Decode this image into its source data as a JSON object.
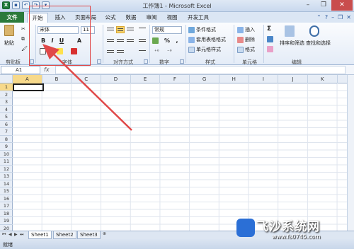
{
  "window": {
    "title": "工作簿1 - Microsoft Excel"
  },
  "tabs": {
    "file": "文件",
    "home": "开始",
    "insert": "插入",
    "layout": "页面布局",
    "formulas": "公式",
    "data": "数据",
    "review": "审阅",
    "view": "视图",
    "developer": "开发工具"
  },
  "ribbon": {
    "clipboard": {
      "paste": "粘贴",
      "label": "剪贴板"
    },
    "font": {
      "name": "宋体",
      "size": "11",
      "bold": "B",
      "italic": "I",
      "underline": "U",
      "grow": "A",
      "label": "字体"
    },
    "alignment": {
      "label": "对齐方式"
    },
    "number": {
      "format": "常规",
      "percent": "%",
      "comma": ",",
      "label": "数字"
    },
    "styles": {
      "conditional": "条件格式",
      "table": "套用表格格式",
      "cell": "单元格样式",
      "label": "样式"
    },
    "cells": {
      "insert": "插入",
      "delete": "删除",
      "format": "格式",
      "label": "单元格"
    },
    "editing": {
      "sigma": "Σ",
      "sort": "排序和筛选",
      "find": "查找和选择",
      "label": "编辑"
    }
  },
  "formula_bar": {
    "name_box": "A1",
    "fx": "fx"
  },
  "grid": {
    "columns": [
      "A",
      "B",
      "C",
      "D",
      "E",
      "F",
      "G",
      "H",
      "I",
      "J",
      "K"
    ],
    "rows": [
      "1",
      "2",
      "3",
      "4",
      "5",
      "6",
      "7",
      "8",
      "9",
      "10",
      "11",
      "12",
      "13",
      "14",
      "15",
      "16",
      "17",
      "18",
      "19",
      "20"
    ]
  },
  "sheets": [
    "Sheet1",
    "Sheet2",
    "Sheet3"
  ],
  "status": {
    "ready": "就绪"
  },
  "watermark": {
    "title": "飞沙系统网",
    "url": "www.fs0745.com"
  },
  "colors": {
    "file_tab": "#2b7a3b",
    "annotation": "#e04848",
    "selection": "#f7d98a"
  }
}
